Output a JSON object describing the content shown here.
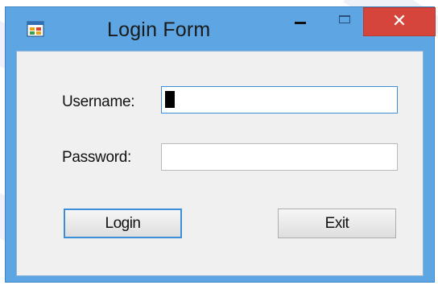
{
  "window": {
    "title": "Login Form",
    "close_symbol": "✕",
    "icons": {
      "app": "form-app-icon",
      "minimize": "minimize-icon",
      "maximize": "maximize-icon",
      "close": "close-icon"
    },
    "colors": {
      "frame": "#5ea6e3",
      "close_button": "#d5453b",
      "client_bg": "#f0f0f0",
      "focus_border": "#3c8fd6"
    }
  },
  "form": {
    "username_label": "Username:",
    "password_label": "Password:",
    "username_value": "",
    "password_value": "",
    "login_label": "Login",
    "exit_label": "Exit"
  }
}
